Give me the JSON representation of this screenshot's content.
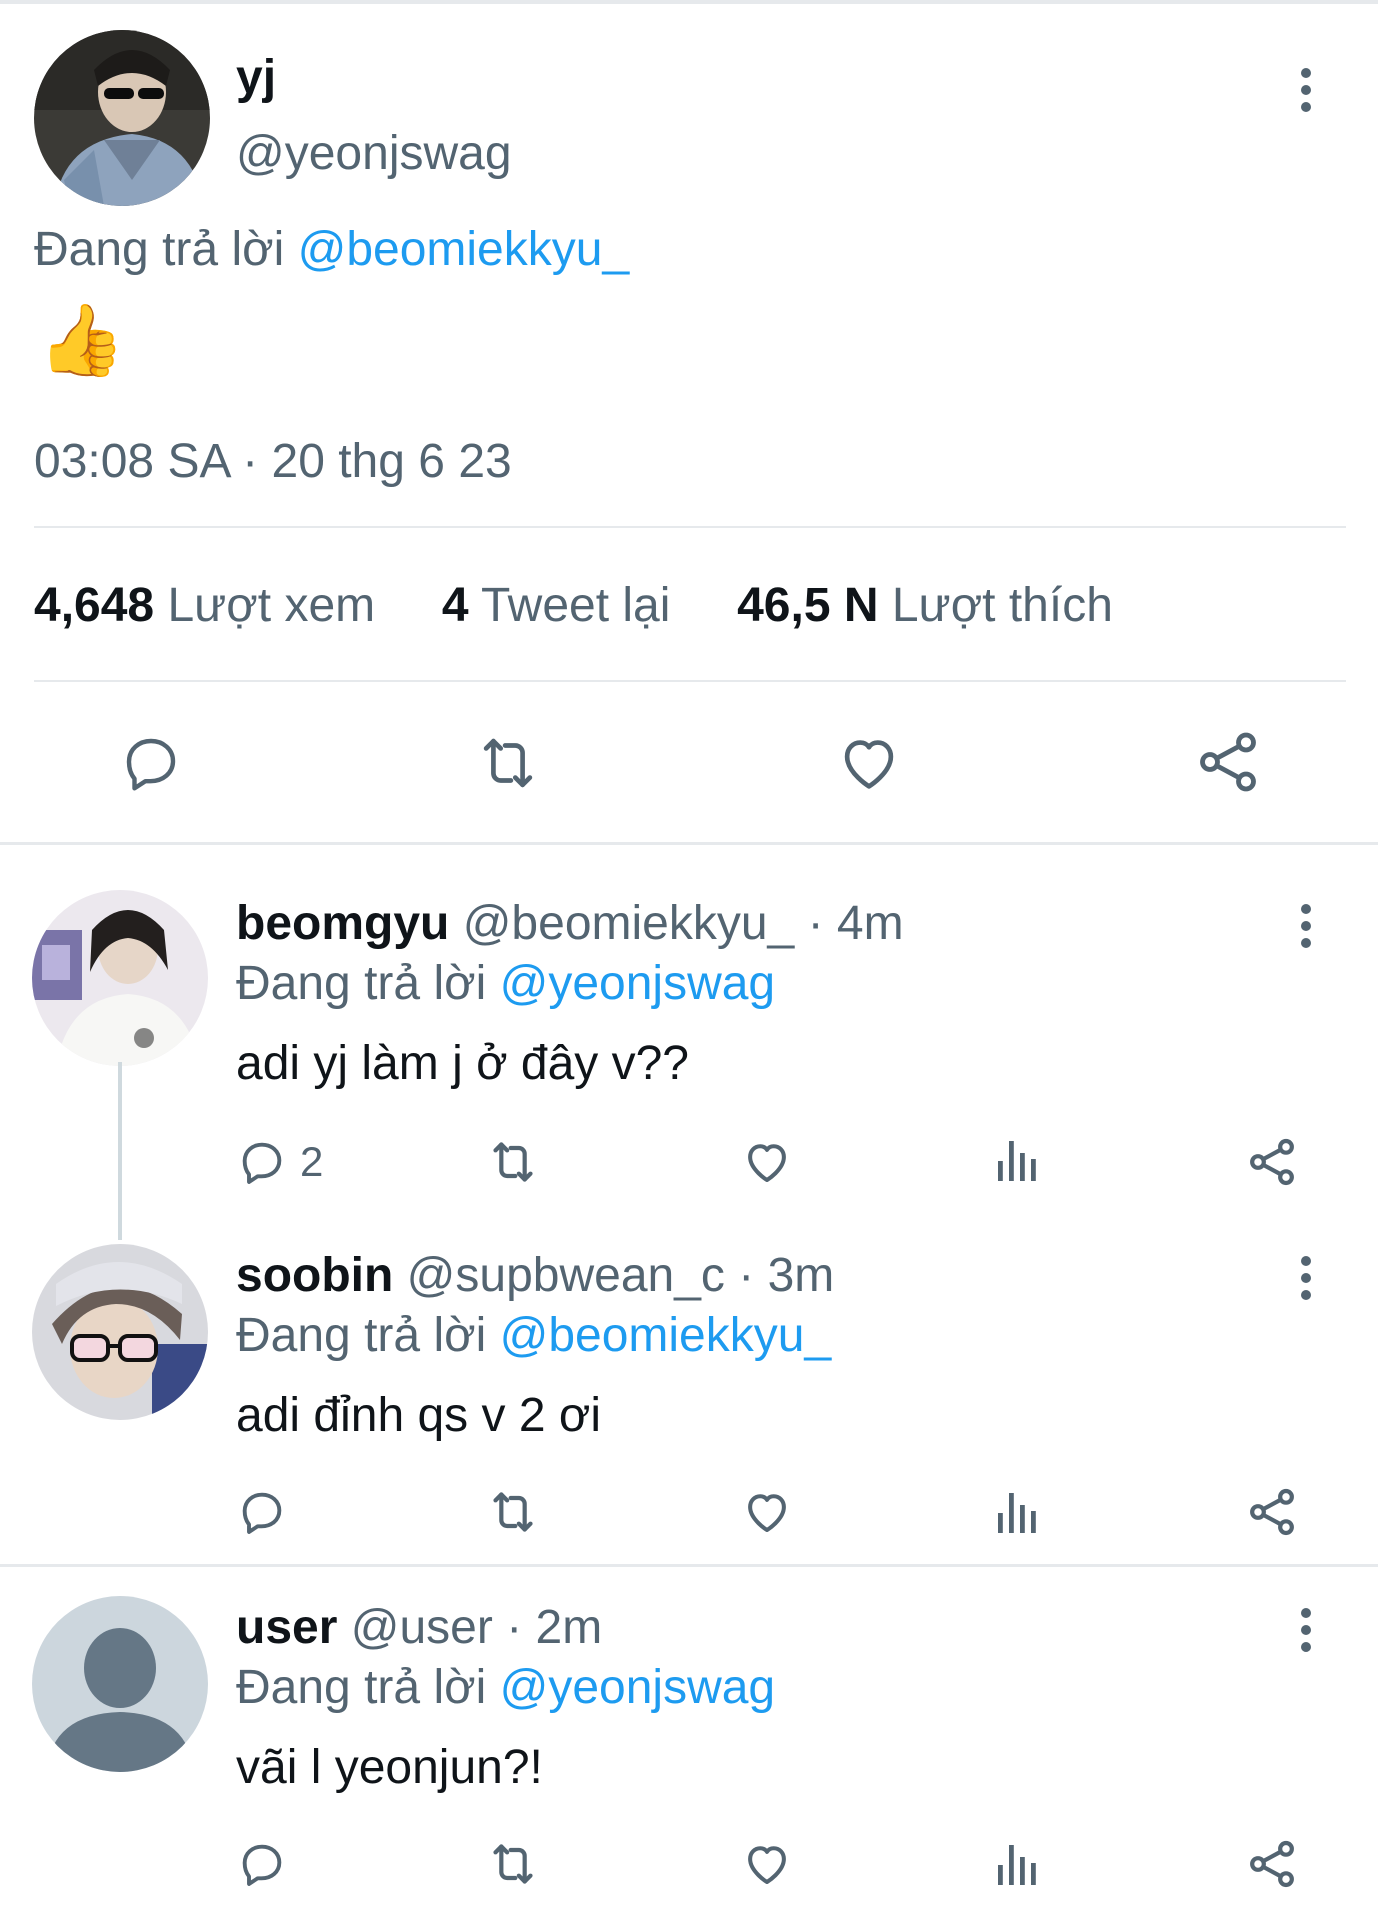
{
  "main_tweet": {
    "display_name": "yj",
    "handle": "@yeonjswag",
    "replying_prefix": "Đang trả lời",
    "replying_to": "@beomiekkyu_",
    "emoji": "👍",
    "timestamp": "03:08 SA · 20 thg 6 23",
    "stats": {
      "views_value": "4,648",
      "views_label": "Lượt xem",
      "retweets_value": "4",
      "retweets_label": "Tweet lại",
      "likes_value": "46,5 N",
      "likes_label": "Lượt thích"
    }
  },
  "replies": [
    {
      "display_name": "beomgyu",
      "handle": "@beomiekkyu_",
      "time": "· 4m",
      "replying_prefix": "Đang trả lời",
      "replying_to": "@yeonjswag",
      "text": "adi yj làm j ở đây v??",
      "reply_count": "2"
    },
    {
      "display_name": "soobin",
      "handle": "@supbwean_c",
      "time": "· 3m",
      "replying_prefix": "Đang trả lời",
      "replying_to": "@beomiekkyu_",
      "text": "adi đỉnh qs v 2 ơi",
      "reply_count": ""
    },
    {
      "display_name": "user",
      "handle": "@user",
      "time": "· 2m",
      "replying_prefix": "Đang trả lời",
      "replying_to": "@yeonjswag",
      "text": "vãi l yeonjun?!",
      "reply_count": ""
    }
  ],
  "colors": {
    "accent": "#1d9bf0",
    "muted": "#536471",
    "text": "#0f1419",
    "divider": "#e6e9ec"
  },
  "icons": [
    "comment-icon",
    "retweet-icon",
    "like-icon",
    "share-icon",
    "views-icon",
    "more-icon"
  ]
}
